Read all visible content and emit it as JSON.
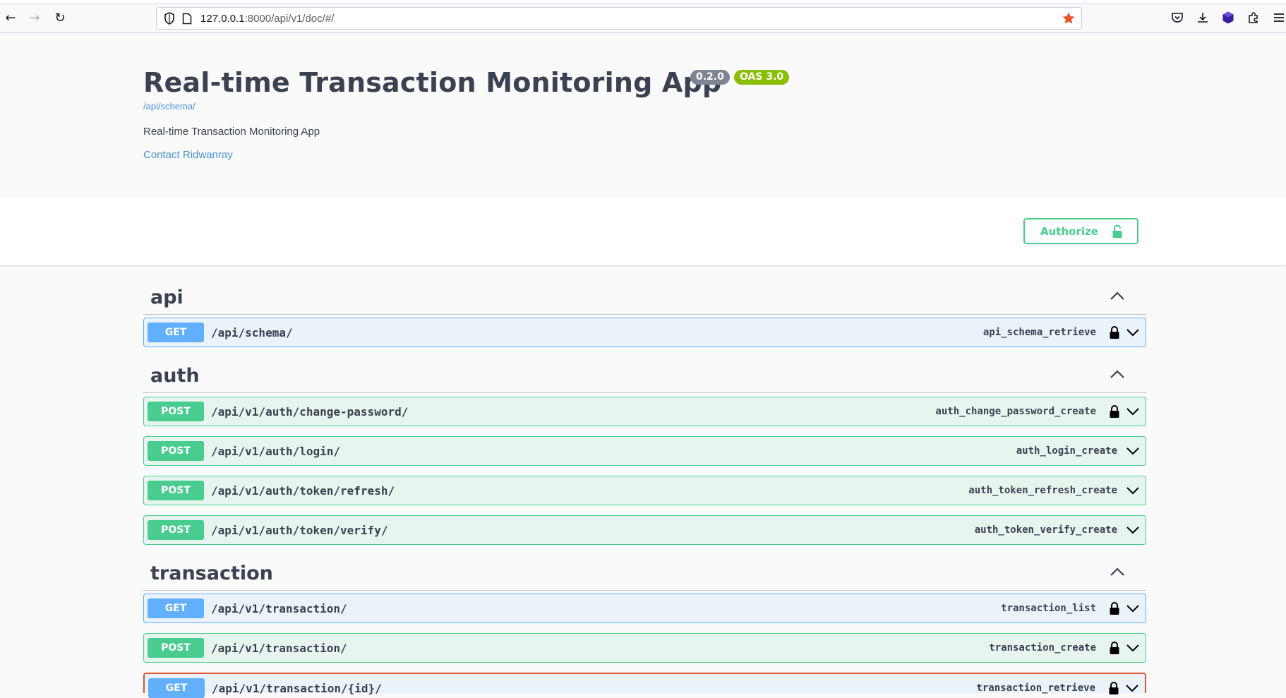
{
  "browser": {
    "url_host": "127.0.0.1",
    "url_rest": ":8000/api/v1/doc/#/",
    "back_icon": "arrow-left-icon",
    "forward_icon": "arrow-right-icon",
    "reload_icon": "reload-icon"
  },
  "info": {
    "title": "Real-time Transaction Monitoring App",
    "version": "0.2.0",
    "oas": "OAS 3.0",
    "schema_link": "/api/schema/",
    "description": "Real-time Transaction Monitoring App",
    "contact": "Contact Ridwanray"
  },
  "authorize": {
    "label": "Authorize"
  },
  "colors": {
    "get": "#61affe",
    "post": "#49cc90",
    "title": "#3b4151",
    "link": "#4990e2",
    "oas_badge": "#89bf04",
    "version_badge": "#7d8492"
  },
  "tags": [
    {
      "name": "api"
    },
    {
      "name": "auth"
    },
    {
      "name": "transaction"
    }
  ],
  "operations": [
    {
      "method": "GET",
      "path": "/api/schema/",
      "operation_id": "api_schema_retrieve",
      "locked": true
    },
    {
      "method": "POST",
      "path": "/api/v1/auth/change-password/",
      "operation_id": "auth_change_password_create",
      "locked": true
    },
    {
      "method": "POST",
      "path": "/api/v1/auth/login/",
      "operation_id": "auth_login_create",
      "locked": false
    },
    {
      "method": "POST",
      "path": "/api/v1/auth/token/refresh/",
      "operation_id": "auth_token_refresh_create",
      "locked": false
    },
    {
      "method": "POST",
      "path": "/api/v1/auth/token/verify/",
      "operation_id": "auth_token_verify_create",
      "locked": false
    },
    {
      "method": "GET",
      "path": "/api/v1/transaction/",
      "operation_id": "transaction_list",
      "locked": true
    },
    {
      "method": "POST",
      "path": "/api/v1/transaction/",
      "operation_id": "transaction_create",
      "locked": true
    },
    {
      "method": "GET",
      "path": "/api/v1/transaction/{id}/",
      "operation_id": "transaction_retrieve",
      "locked": true
    }
  ]
}
